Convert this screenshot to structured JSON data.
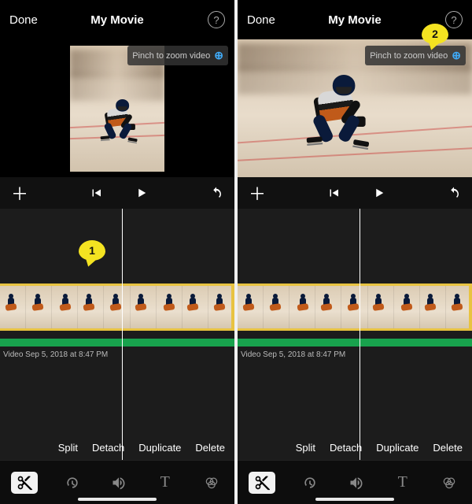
{
  "left": {
    "header": {
      "done": "Done",
      "title": "My Movie",
      "help": "?"
    },
    "zoom_tip": "Pinch to zoom video",
    "timeline_meta": "Video Sep 5, 2018 at 8:47 PM",
    "callout": "1",
    "actions": {
      "split": "Split",
      "detach": "Detach",
      "duplicate": "Duplicate",
      "delete": "Delete"
    },
    "bottom": {
      "text_label": "T"
    }
  },
  "right": {
    "header": {
      "done": "Done",
      "title": "My Movie",
      "help": "?"
    },
    "zoom_tip": "Pinch to zoom video",
    "timeline_meta": "Video Sep 5, 2018 at 8:47 PM",
    "callout": "2",
    "actions": {
      "split": "Split",
      "detach": "Detach",
      "duplicate": "Duplicate",
      "delete": "Delete"
    },
    "bottom": {
      "text_label": "T"
    }
  }
}
